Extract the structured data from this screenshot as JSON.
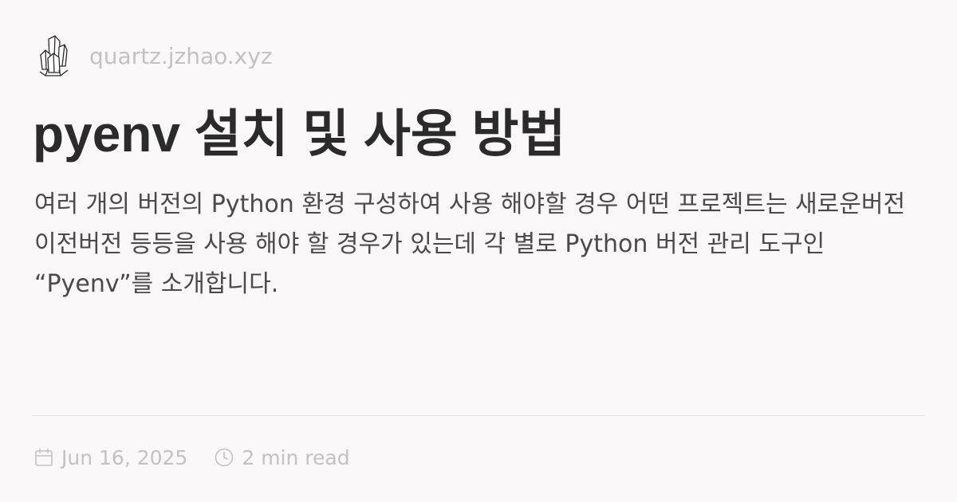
{
  "site": {
    "domain": "quartz.jzhao.xyz",
    "logo_icon": "crystal-logo-icon"
  },
  "article": {
    "title": "pyenv 설치 및 사용 방법",
    "description": "여러 개의 버전의 Python 환경 구성하여 사용 해야할 경우 어떤 프로젝트는 새로운버전 이전버전 등등을 사용 해야 할 경우가 있는데 각 별로 Python 버전 관리 도구인 “Pyenv”를 소개합니다."
  },
  "meta": {
    "date": "Jun 16, 2025",
    "date_icon": "calendar-icon",
    "read_time": "2 min read",
    "read_time_icon": "clock-icon"
  },
  "colors": {
    "background": "#faf8f8",
    "title": "#2b2b2b",
    "body_text": "#4a4a4a",
    "muted": "#c4c1c1",
    "divider": "#e5e2e2"
  }
}
